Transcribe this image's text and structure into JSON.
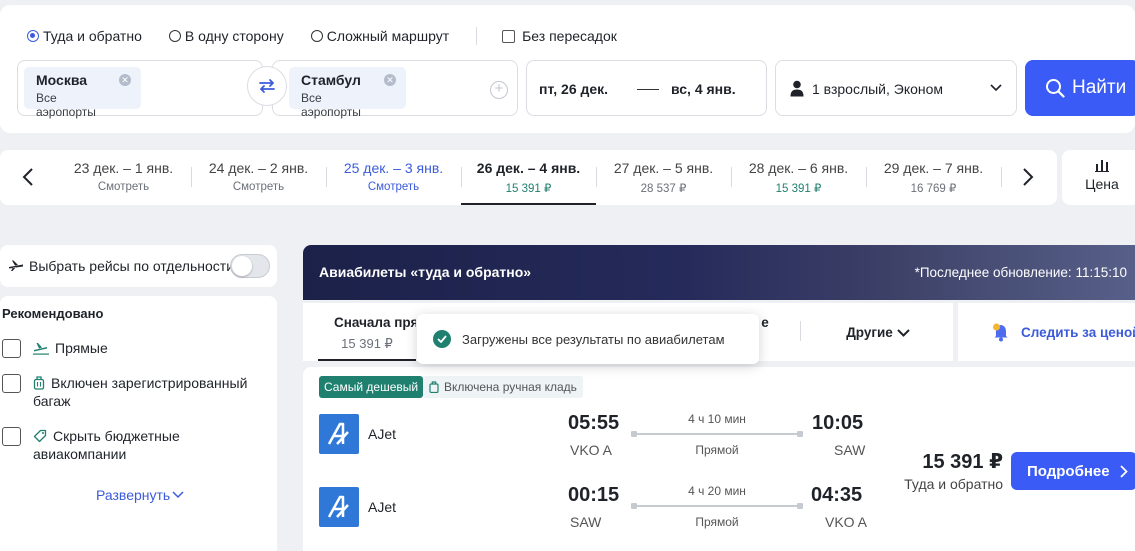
{
  "search": {
    "trip_types": [
      {
        "label": "Туда и обратно",
        "checked": true
      },
      {
        "label": "В одну сторону",
        "checked": false
      },
      {
        "label": "Сложный маршрут",
        "checked": false
      }
    ],
    "no_transfers_label": "Без пересадок",
    "origin": {
      "city": "Москва",
      "airports": "Все аэропорты"
    },
    "destination": {
      "city": "Стамбул",
      "airports": "Все аэропорты"
    },
    "depart_date": "пт, 26 дек.",
    "return_date": "вс, 4 янв.",
    "passengers": "1 взрослый, Эконом",
    "find_label": "Найти"
  },
  "date_strip": {
    "cells": [
      {
        "label": "23 дек. – 1 янв.",
        "sub": "Смотреть"
      },
      {
        "label": "24 дек. – 2 янв.",
        "sub": "Смотреть"
      },
      {
        "label": "25 дек. – 3 янв.",
        "sub": "Смотреть"
      },
      {
        "label": "26 дек. – 4 янв.",
        "sub": "15 391 ₽"
      },
      {
        "label": "27 дек. – 5 янв.",
        "sub": "28 537 ₽"
      },
      {
        "label": "28 дек. – 6 янв.",
        "sub": "15 391 ₽"
      },
      {
        "label": "29 дек. – 7 янв.",
        "sub": "16 769 ₽"
      }
    ],
    "price_tab_label": "Цена"
  },
  "filters": {
    "separate_flights_label": "Выбрать рейсы по отдельности",
    "recommended_title": "Рекомендовано",
    "items": [
      {
        "label": "Прямые"
      },
      {
        "label": "Включен зарегистрированный багаж"
      },
      {
        "label": "Скрыть бюджетные авиакомпании"
      }
    ],
    "expand_label": "Развернуть"
  },
  "results": {
    "banner_title": "Авиабилеты «туда и обратно»",
    "last_update": "*Последнее обновление: 11:15:10",
    "sort_tabs": [
      {
        "label": "Сначала прям",
        "price": "15 391 ₽"
      },
      {
        "label": "Другие"
      }
    ],
    "track_price_label": "Следить за ценой",
    "toast_text": "Загружены все результаты по авиабилетам",
    "ticket": {
      "badge_cheapest": "Самый дешевый",
      "badge_hand_luggage": "Включена ручная кладь",
      "legs": [
        {
          "airline": "AJet",
          "dep_time": "05:55",
          "dep_code": "VKO A",
          "duration": "4 ч 10 мин",
          "stops": "Прямой",
          "arr_time": "10:05",
          "arr_code": "SAW"
        },
        {
          "airline": "AJet",
          "dep_time": "00:15",
          "dep_code": "SAW",
          "duration": "4 ч 20 мин",
          "stops": "Прямой",
          "arr_time": "04:35",
          "arr_code": "VKO A"
        }
      ],
      "price": "15 391 ₽",
      "price_note": "Туда и обратно",
      "details_label": "Подробнее"
    }
  },
  "colors": {
    "accent": "#3b5bf6",
    "link": "#3b5bdb",
    "cheap_green": "#208070",
    "banner_dark": "#1c2149"
  }
}
